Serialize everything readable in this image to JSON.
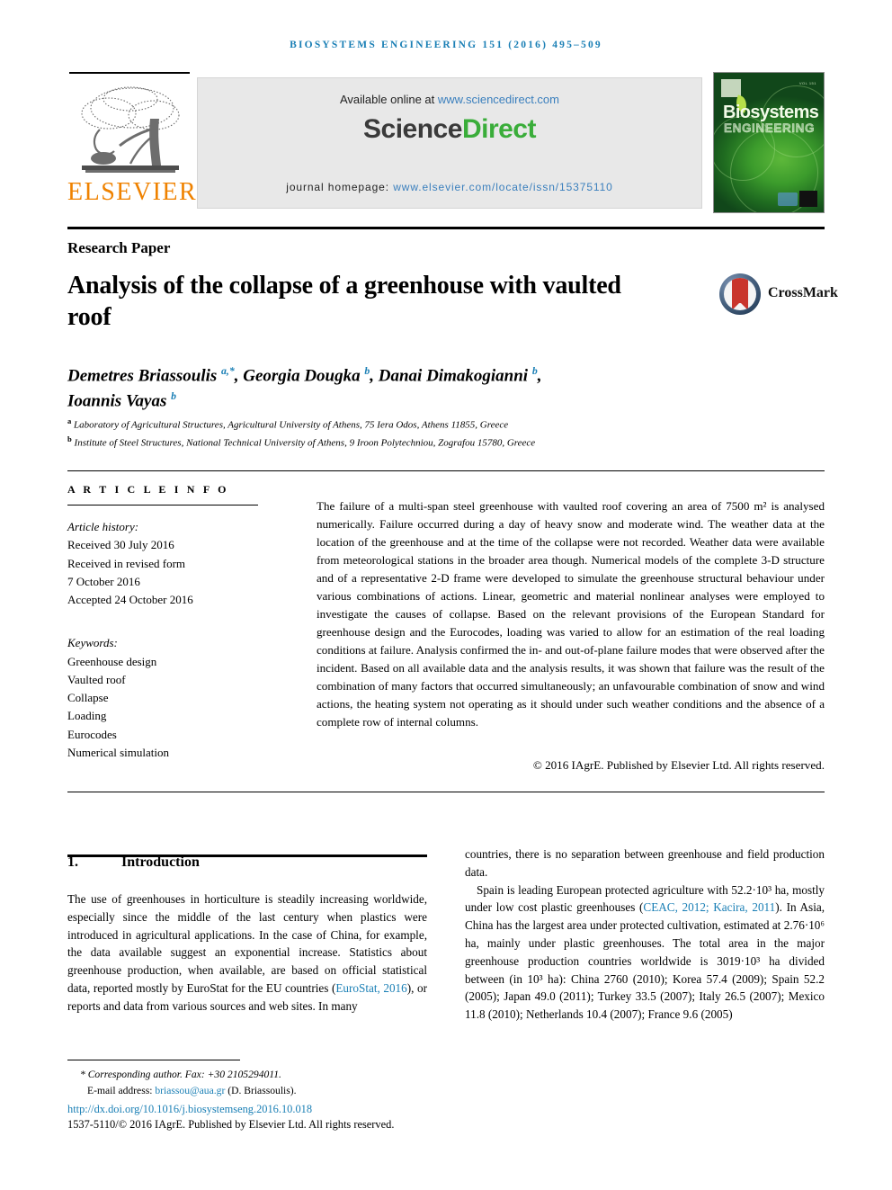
{
  "running_head": "Biosystems Engineering 151 (2016) 495–509",
  "masthead": {
    "elsevier_wordmark": "ELSEVIER",
    "available_prefix": "Available online at ",
    "available_url": "www.sciencedirect.com",
    "brand_first": "Science",
    "brand_second": "Direct",
    "homepage_label": "journal homepage: ",
    "homepage_url": "www.elsevier.com/locate/issn/15375110",
    "cover_title_line1": "Biosystems",
    "cover_title_line2": "ENGINEERING",
    "cover_volume": "VOL 151"
  },
  "article": {
    "type_label": "Research Paper",
    "title": "Analysis of the collapse of a greenhouse with vaulted roof",
    "crossmark_label": "CrossMark",
    "authors_line1_a": "Demetres Briassoulis ",
    "authors_line1_a_sup": "a,*",
    "authors_line1_b": ", Georgia Dougka ",
    "authors_line1_b_sup": "b",
    "authors_line1_c": ", Danai Dimakogianni ",
    "authors_line1_c_sup": "b",
    "authors_line1_d": ",",
    "authors_line2": "Ioannis Vayas ",
    "authors_line2_sup": "b",
    "affiliation_a_marker": "a",
    "affiliation_a": " Laboratory of Agricultural Structures, Agricultural University of Athens, 75 Iera Odos, Athens 11855, Greece",
    "affiliation_b_marker": "b",
    "affiliation_b": " Institute of Steel Structures, National Technical University of Athens, 9 Iroon Polytechniou, Zografou 15780, Greece"
  },
  "article_info": {
    "heading": "A R T I C L E   I N F O",
    "history_label": "Article history:",
    "history": [
      "Received 30 July 2016",
      "Received in revised form",
      "7 October 2016",
      "Accepted 24 October 2016"
    ],
    "keywords_label": "Keywords:",
    "keywords": [
      "Greenhouse design",
      "Vaulted roof",
      "Collapse",
      "Loading",
      "Eurocodes",
      "Numerical simulation"
    ]
  },
  "abstract": {
    "text": "The failure of a multi-span steel greenhouse with vaulted roof covering an area of 7500 m² is analysed numerically. Failure occurred during a day of heavy snow and moderate wind. The weather data at the location of the greenhouse and at the time of the collapse were not recorded. Weather data were available from meteorological stations in the broader area though. Numerical models of the complete 3-D structure and of a representative 2-D frame were developed to simulate the greenhouse structural behaviour under various combinations of actions. Linear, geometric and material nonlinear analyses were employed to investigate the causes of collapse. Based on the relevant provisions of the European Standard for greenhouse design and the Eurocodes, loading was varied to allow for an estimation of the real loading conditions at failure. Analysis confirmed the in- and out-of-plane failure modes that were observed after the incident. Based on all available data and the analysis results, it was shown that failure was the result of the combination of many factors that occurred simultaneously; an unfavourable combination of snow and wind actions, the heating system not operating as it should under such weather conditions and the absence of a complete row of internal columns.",
    "copyright": "© 2016 IAgrE. Published by Elsevier Ltd. All rights reserved."
  },
  "body": {
    "section_number": "1.",
    "section_title": "Introduction",
    "left_p1_a": "The use of greenhouses in horticulture is steadily increasing worldwide, especially since the middle of the last century when plastics were introduced in agricultural applications. In the case of China, for example, the data available suggest an exponential increase. Statistics about greenhouse production, when available, are based on official statistical data, reported mostly by EuroStat for the EU countries (",
    "left_p1_ref": "EuroStat, 2016",
    "left_p1_b": "), or reports and data from various sources and web sites. In many",
    "right_p1": "countries, there is no separation between greenhouse and field production data.",
    "right_p2_a": "Spain is leading European protected agriculture with 52.2·10³ ha, mostly under low cost plastic greenhouses (",
    "right_p2_ref": "CEAC, 2012; Kacira, 2011",
    "right_p2_b": "). In Asia, China has the largest area under protected cultivation, estimated at 2.76·10⁶ ha, mainly under plastic greenhouses. The total area in the major greenhouse production countries worldwide is 3019·10³ ha divided between (in 10³ ha): China 2760 (2010); Korea 57.4 (2009); Spain 52.2 (2005); Japan 49.0 (2011); Turkey 33.5 (2007); Italy 26.5 (2007); Mexico 11.8 (2010); Netherlands 10.4 (2007); France 9.6 (2005)"
  },
  "footer": {
    "corresponding": "* Corresponding author. Fax: +30 2105294011.",
    "email_label": "E-mail address: ",
    "email": "briassou@aua.gr",
    "email_suffix": " (D. Briassoulis).",
    "doi": "http://dx.doi.org/10.1016/j.biosystemseng.2016.10.018",
    "issn": "1537-5110/© 2016 IAgrE. Published by Elsevier Ltd. All rights reserved."
  },
  "colors": {
    "link": "#1a7fb5",
    "elsevier_orange": "#ef8200",
    "sciencedirect_green": "#3aad3a",
    "crossmark_red": "#c9352c",
    "crossmark_blue": "#2e4763"
  }
}
